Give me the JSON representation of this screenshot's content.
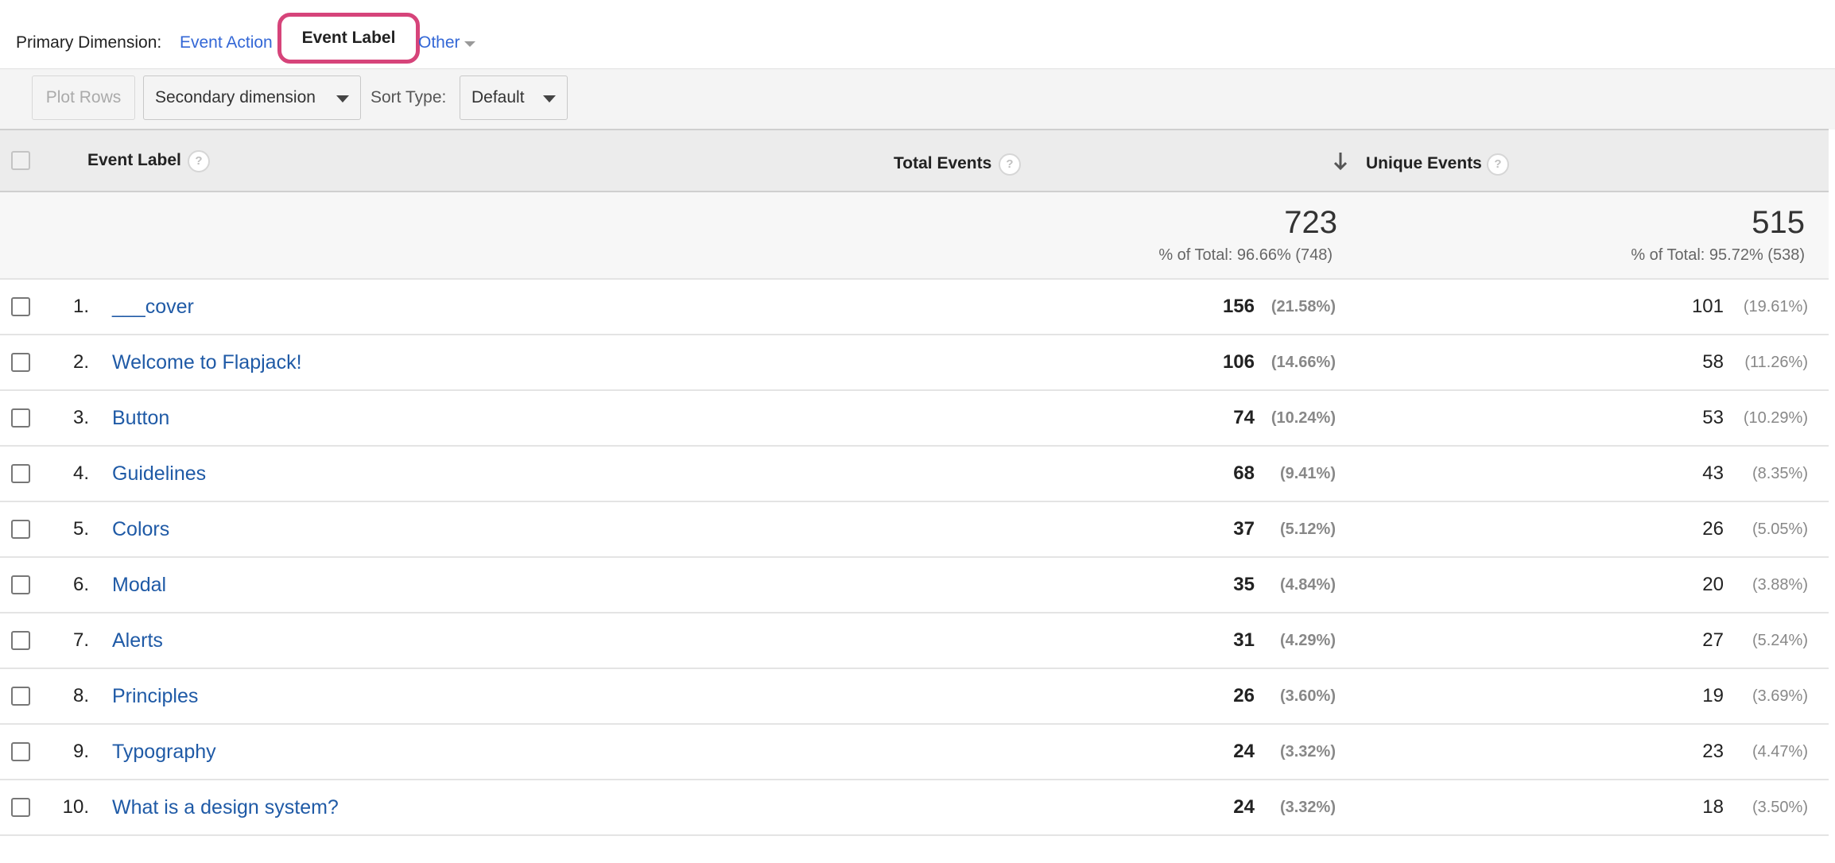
{
  "primary_dimension": {
    "label": "Primary Dimension:",
    "options": [
      {
        "label": "Event Action",
        "active": false
      },
      {
        "label": "Event Label",
        "active": true
      },
      {
        "label": "Other",
        "active": false
      }
    ]
  },
  "toolbar": {
    "plot_rows": "Plot Rows",
    "secondary_dimension": "Secondary dimension",
    "sort_type_label": "Sort Type:",
    "sort_type_value": "Default"
  },
  "table": {
    "columns": {
      "label": "Event Label",
      "total": "Total Events",
      "unique": "Unique Events",
      "help_glyph": "?"
    },
    "totals": {
      "total_events": "723",
      "total_events_sub": "% of Total: 96.66% (748)",
      "unique_events": "515",
      "unique_events_sub": "% of Total: 95.72% (538)"
    },
    "rows": [
      {
        "index": "1.",
        "label": "___cover",
        "total": "156",
        "total_pct": "(21.58%)",
        "unique": "101",
        "unique_pct": "(19.61%)"
      },
      {
        "index": "2.",
        "label": "Welcome to Flapjack!",
        "total": "106",
        "total_pct": "(14.66%)",
        "unique": "58",
        "unique_pct": "(11.26%)"
      },
      {
        "index": "3.",
        "label": "Button",
        "total": "74",
        "total_pct": "(10.24%)",
        "unique": "53",
        "unique_pct": "(10.29%)"
      },
      {
        "index": "4.",
        "label": "Guidelines",
        "total": "68",
        "total_pct": "(9.41%)",
        "unique": "43",
        "unique_pct": "(8.35%)"
      },
      {
        "index": "5.",
        "label": "Colors",
        "total": "37",
        "total_pct": "(5.12%)",
        "unique": "26",
        "unique_pct": "(5.05%)"
      },
      {
        "index": "6.",
        "label": "Modal",
        "total": "35",
        "total_pct": "(4.84%)",
        "unique": "20",
        "unique_pct": "(3.88%)"
      },
      {
        "index": "7.",
        "label": "Alerts",
        "total": "31",
        "total_pct": "(4.29%)",
        "unique": "27",
        "unique_pct": "(5.24%)"
      },
      {
        "index": "8.",
        "label": "Principles",
        "total": "26",
        "total_pct": "(3.60%)",
        "unique": "19",
        "unique_pct": "(3.69%)"
      },
      {
        "index": "9.",
        "label": "Typography",
        "total": "24",
        "total_pct": "(3.32%)",
        "unique": "23",
        "unique_pct": "(4.47%)"
      },
      {
        "index": "10.",
        "label": "What is a design system?",
        "total": "24",
        "total_pct": "(3.32%)",
        "unique": "18",
        "unique_pct": "(3.50%)"
      }
    ]
  },
  "colors": {
    "link": "#3367d6",
    "row_link": "#1f5aa6",
    "highlight": "#d6447a"
  },
  "icons": {
    "sort": "arrow-down-icon",
    "help": "help-circle-icon",
    "dropdown": "caret-down-icon"
  }
}
